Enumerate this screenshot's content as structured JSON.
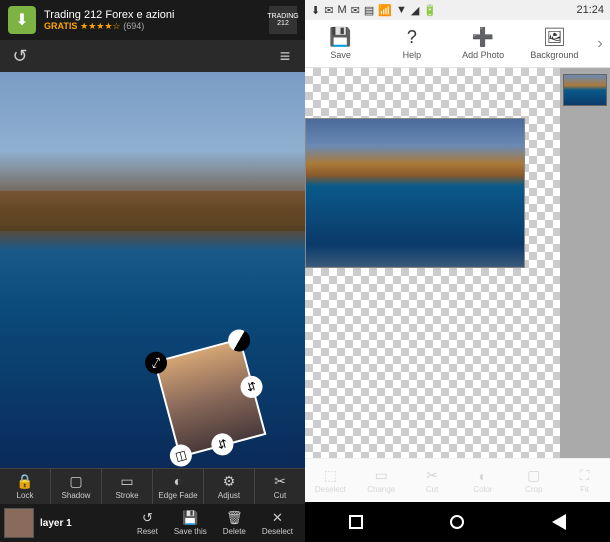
{
  "left": {
    "ad": {
      "title": "Trading 212 Forex e azioni",
      "gratis": "GRATIS",
      "stars": "★★★★☆",
      "count": "(694)",
      "logo": "TRADING 212",
      "download_icon": "⬇"
    },
    "top": {
      "undo_icon": "↺",
      "menu_icon": "≡"
    },
    "handles": {
      "rotate": "⟲",
      "scale": "◐",
      "flip": "⇵",
      "mirror": "◫",
      "move": "⤢"
    },
    "toolbar_row1": [
      {
        "icon": "🔒",
        "label": "Lock"
      },
      {
        "icon": "▢",
        "label": "Shadow"
      },
      {
        "icon": "▭",
        "label": "Stroke"
      },
      {
        "icon": "◐",
        "label": "Edge Fade"
      },
      {
        "icon": "⚙",
        "label": "Adjust"
      },
      {
        "icon": "✂",
        "label": "Cut"
      }
    ],
    "layer": {
      "label": "layer 1"
    },
    "layer_btns": [
      {
        "icon": "↺",
        "label": "Reset"
      },
      {
        "icon": "💾",
        "label": "Save this"
      },
      {
        "icon": "🗑",
        "label": "Delete"
      },
      {
        "icon": "✕",
        "label": "Deselect"
      }
    ]
  },
  "right": {
    "status": {
      "time": "21:24",
      "icons": [
        "⬇",
        "✉",
        "M",
        "✉",
        "▤",
        "📶",
        "▼",
        "◢",
        "🔋"
      ]
    },
    "toolbar": [
      {
        "icon": "💾",
        "label": "Save"
      },
      {
        "icon": "?",
        "label": "Help"
      },
      {
        "icon": "➕",
        "label": "Add Photo"
      },
      {
        "icon": "🖼",
        "label": "Background"
      }
    ],
    "more": "›",
    "bottom_tools": [
      {
        "icon": "⬚",
        "label": "Deselect"
      },
      {
        "icon": "▭",
        "label": "Change"
      },
      {
        "icon": "✂",
        "label": "Cut"
      },
      {
        "icon": "◐",
        "label": "Color"
      },
      {
        "icon": "▢",
        "label": "Crop"
      },
      {
        "icon": "⛶",
        "label": "Fit"
      }
    ]
  }
}
